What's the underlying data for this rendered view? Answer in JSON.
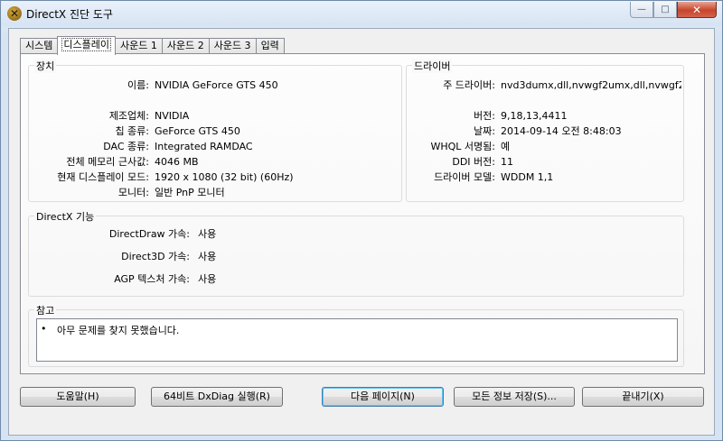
{
  "window": {
    "title": "DirectX 진단 도구",
    "icon": "directx-x-icon",
    "controls": {
      "minimize": "—",
      "maximize": "□",
      "close": "✕"
    }
  },
  "tabs": [
    {
      "label": "시스템",
      "active": false
    },
    {
      "label": "디스플레이",
      "active": true
    },
    {
      "label": "사운드 1",
      "active": false
    },
    {
      "label": "사운드 2",
      "active": false
    },
    {
      "label": "사운드 3",
      "active": false
    },
    {
      "label": "입력",
      "active": false
    }
  ],
  "device": {
    "heading": "장치",
    "rows": [
      {
        "label": "이름:",
        "value": "NVIDIA GeForce GTS 450"
      },
      {
        "label": "제조업체:",
        "value": "NVIDIA"
      },
      {
        "label": "칩 종류:",
        "value": "GeForce GTS 450"
      },
      {
        "label": "DAC 종류:",
        "value": "Integrated RAMDAC"
      },
      {
        "label": "전체 메모리 근사값:",
        "value": "4046 MB"
      },
      {
        "label": "현재 디스플레이 모드:",
        "value": "1920 x 1080 (32 bit) (60Hz)"
      },
      {
        "label": "모니터:",
        "value": "일반 PnP 모니터"
      }
    ]
  },
  "driver": {
    "heading": "드라이버",
    "rows": [
      {
        "label": "주 드라이버:",
        "value": "nvd3dumx,dll,nvwgf2umx,dll,nvwgf2u"
      },
      {
        "label": "버전:",
        "value": "9,18,13,4411"
      },
      {
        "label": "날짜:",
        "value": "2014-09-14 오전 8:48:03"
      },
      {
        "label": "WHQL 서명됨:",
        "value": "예"
      },
      {
        "label": "DDI 버전:",
        "value": "11"
      },
      {
        "label": "드라이버 모델:",
        "value": "WDDM 1,1"
      }
    ]
  },
  "features": {
    "heading": "DirectX 기능",
    "rows": [
      {
        "label": "DirectDraw 가속:",
        "value": "사용"
      },
      {
        "label": "Direct3D 가속:",
        "value": "사용"
      },
      {
        "label": "AGP 텍스처 가속:",
        "value": "사용"
      }
    ]
  },
  "notes": {
    "heading": "참고",
    "bullet": "•",
    "items": [
      "아무 문제를 찾지 못했습니다."
    ]
  },
  "buttons": {
    "help": "도움말(H)",
    "run64": "64비트 DxDiag 실행(R)",
    "next": "다음 페이지(N)",
    "save": "모든 정보 저장(S)...",
    "exit": "끝내기(X)"
  }
}
